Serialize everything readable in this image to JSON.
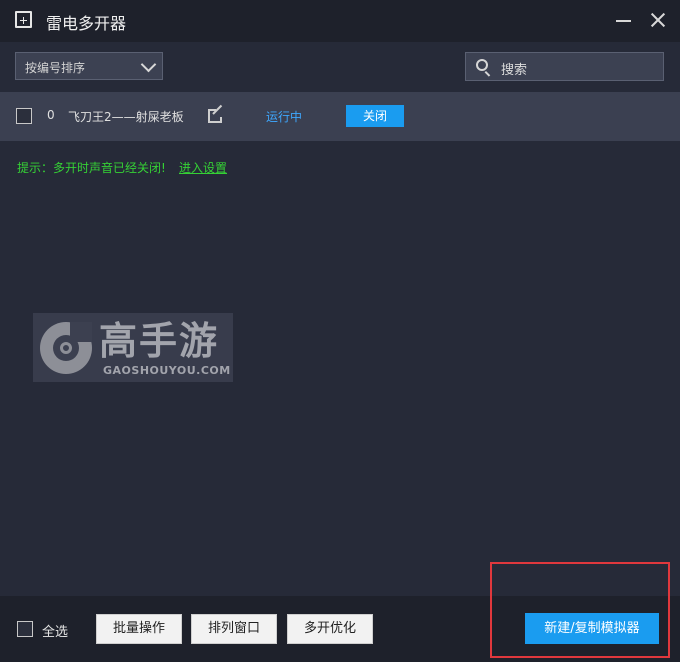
{
  "window": {
    "title": "雷电多开器"
  },
  "toolbar": {
    "sort_value": "按编号排序",
    "search_placeholder": "搜索"
  },
  "emulators": [
    {
      "index": "0",
      "name": "飞刀王2——射屎老板",
      "status": "运行中",
      "action_label": "关闭"
    }
  ],
  "notice": {
    "text": "提示：多开时声音已经关闭!",
    "link_label": "进入设置"
  },
  "watermark": {
    "brand_cn": "高手游",
    "brand_en": "GAOSHOUYOU.COM"
  },
  "bottom": {
    "select_all_label": "全选",
    "batch_label": "批量操作",
    "arrange_label": "排列窗口",
    "optimize_label": "多开优化",
    "new_label": "新建/复制模拟器"
  },
  "colors": {
    "background": "#262a38",
    "titlebar": "#1e212b",
    "row": "#3b4051",
    "accent_blue": "#1a9cf0",
    "status_blue": "#3ea8ff",
    "notice_green": "#35d135",
    "highlight_red": "#e0383d"
  },
  "icons": {
    "app": "add-window-icon",
    "minimize": "minimize-icon",
    "close": "close-icon",
    "dropdown": "chevron-down-icon",
    "search": "search-icon",
    "edit": "edit-icon"
  }
}
